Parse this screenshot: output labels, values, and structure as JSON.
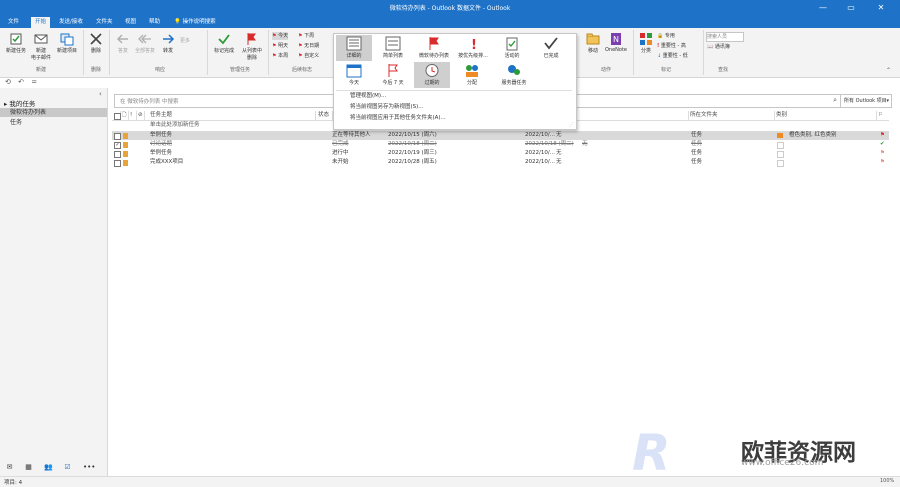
{
  "window": {
    "title": "微软待办列表 - Outlook 数据文件  -  Outlook",
    "minimize": "—",
    "restore": "▭",
    "close": "✕"
  },
  "tabs": [
    "文件",
    "开始",
    "发送/接收",
    "文件夹",
    "视图",
    "帮助"
  ],
  "tell_me": "操作说明搜索",
  "ribbon": {
    "new_task": "新建任务",
    "new_email": "新建\n电子邮件",
    "new_items": "新建项目",
    "group_new": "新建",
    "delete": "删除",
    "group_delete": "删除",
    "reply": "答复",
    "reply_all": "全部答复",
    "forward": "转发",
    "more": "更多",
    "group_respond": "响应",
    "mark_complete": "标记完成",
    "remove_from_list": "从列表中\n删除",
    "group_manage": "管理任务",
    "flags": [
      "今天",
      "明天",
      "本周",
      "下周",
      "无日期",
      "自定义"
    ],
    "group_followup": "后续标志",
    "move": "移动",
    "onenote": "OneNote",
    "group_actions": "动作",
    "categorize": "分类",
    "tags": [
      "专用",
      "重要性 - 高",
      "重要性 - 低"
    ],
    "group_tags": "标记",
    "search_people_placeholder": "搜索人员",
    "address_book": "通讯簿",
    "group_find": "查找"
  },
  "views": {
    "row1": [
      "详细的",
      "简单列表",
      "微软待办列表",
      "按优先级排...",
      "活动的",
      "已完成"
    ],
    "row2": [
      "今天",
      "今后 7 天",
      "过期的",
      "分配",
      "服务器任务"
    ],
    "menu": [
      "管理视图(M)...",
      "将当前视图另存为新视图(S)...",
      "将当前视图应用于其他任务文件夹(A)..."
    ]
  },
  "left_nav": {
    "header": "▸ 我的任务",
    "items": [
      "微软待办列表",
      "任务"
    ],
    "collapse": "‹"
  },
  "search": {
    "placeholder": "在 微软待办列表 中搜索",
    "scope": "所有 Outlook 项目"
  },
  "columns": [
    "任务主题",
    "状态",
    "",
    "",
    "所在文件夹",
    "类别"
  ],
  "add_row": "单击此处添加新任务",
  "tasks": [
    {
      "subject": "举例任务",
      "status": "正在等待其他人",
      "start": "2022/10/15 (周六)",
      "due": "2022/10/...",
      "reminder": "无",
      "folder": "任务",
      "category": "橙色类别, 红色类别",
      "done": false,
      "highlight": true
    },
    {
      "subject": "讨论话题",
      "status": "已完成",
      "start": "2022/10/18 (周二)",
      "due": "2022/10/18 (周二)",
      "reminder": "无",
      "folder": "任务",
      "category": "",
      "done": true,
      "highlight": false
    },
    {
      "subject": "举例任务",
      "status": "进行中",
      "start": "2022/10/19 (周三)",
      "due": "2022/10/...",
      "reminder": "无",
      "folder": "任务",
      "category": "",
      "done": false,
      "highlight": false
    },
    {
      "subject": "完成XXX项目",
      "status": "未开始",
      "start": "2022/10/28 (周五)",
      "due": "2022/10/...",
      "reminder": "无",
      "folder": "任务",
      "category": "",
      "done": false,
      "highlight": false
    }
  ],
  "status_bar": {
    "items": "项目: 4",
    "zoom": "100%"
  },
  "watermark": {
    "logo": "R",
    "cn": "欧菲资源网",
    "url": "www.office26.com"
  },
  "colors": {
    "accent": "#1e73c8",
    "orange": "#f08a24",
    "red": "#d92b2b",
    "green": "#2e9a3a"
  }
}
